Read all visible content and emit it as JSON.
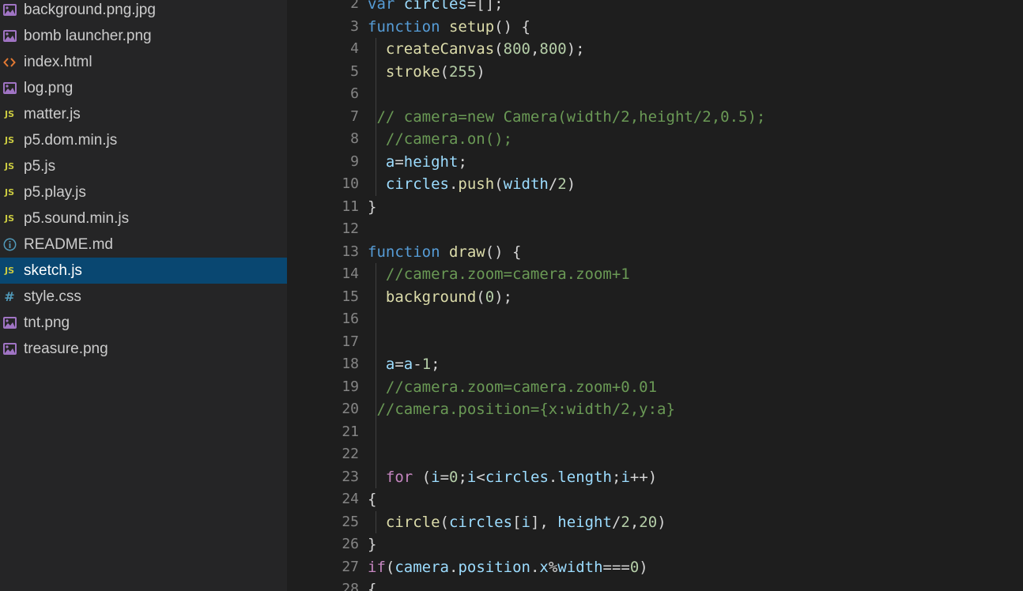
{
  "explorer": {
    "files": [
      {
        "name": "background.png.jpg",
        "icon": "image-file-icon",
        "selected": false
      },
      {
        "name": "bomb launcher.png",
        "icon": "image-file-icon",
        "selected": false
      },
      {
        "name": "index.html",
        "icon": "html-file-icon",
        "selected": false
      },
      {
        "name": "log.png",
        "icon": "image-file-icon",
        "selected": false
      },
      {
        "name": "matter.js",
        "icon": "js-file-icon",
        "selected": false
      },
      {
        "name": "p5.dom.min.js",
        "icon": "js-file-icon",
        "selected": false
      },
      {
        "name": "p5.js",
        "icon": "js-file-icon",
        "selected": false
      },
      {
        "name": "p5.play.js",
        "icon": "js-file-icon",
        "selected": false
      },
      {
        "name": "p5.sound.min.js",
        "icon": "js-file-icon",
        "selected": false
      },
      {
        "name": "README.md",
        "icon": "info-icon",
        "selected": false
      },
      {
        "name": "sketch.js",
        "icon": "js-file-icon",
        "selected": true
      },
      {
        "name": "style.css",
        "icon": "css-hash-icon",
        "selected": false
      },
      {
        "name": "tnt.png",
        "icon": "image-file-icon",
        "selected": false
      },
      {
        "name": "treasure.png",
        "icon": "image-file-icon",
        "selected": false
      }
    ]
  },
  "colors": {
    "sidebar_bg": "#252526",
    "editor_bg": "#1e1e1e",
    "selection": "#094771",
    "keyword": "#569cd6",
    "control": "#c586c0",
    "function": "#dcdcaa",
    "variable": "#9cdcfe",
    "number": "#b5cea8",
    "comment": "#6a9955",
    "js_icon": "#cbcb41",
    "image_icon": "#a074c4",
    "html_icon": "#e37933",
    "info_icon": "#519aba"
  },
  "editor": {
    "lines": [
      {
        "n": "2",
        "tokens": [
          [
            "kw",
            "var"
          ],
          [
            "p",
            " "
          ],
          [
            "var",
            "circles"
          ],
          [
            "p",
            "=[];"
          ]
        ]
      },
      {
        "n": "3",
        "tokens": [
          [
            "kw",
            "function"
          ],
          [
            "p",
            " "
          ],
          [
            "fn",
            "setup"
          ],
          [
            "p",
            "() {"
          ]
        ]
      },
      {
        "n": "4",
        "tokens": [
          [
            "p",
            "  "
          ],
          [
            "fn",
            "createCanvas"
          ],
          [
            "p",
            "("
          ],
          [
            "num",
            "800"
          ],
          [
            "p",
            ","
          ],
          [
            "num",
            "800"
          ],
          [
            "p",
            ");"
          ]
        ]
      },
      {
        "n": "5",
        "tokens": [
          [
            "p",
            "  "
          ],
          [
            "fn",
            "stroke"
          ],
          [
            "p",
            "("
          ],
          [
            "num",
            "255"
          ],
          [
            "p",
            ")"
          ]
        ]
      },
      {
        "n": "6",
        "tokens": []
      },
      {
        "n": "7",
        "tokens": [
          [
            "p",
            " "
          ],
          [
            "cmt",
            "// camera=new Camera(width/2,height/2,0.5);"
          ]
        ]
      },
      {
        "n": "8",
        "tokens": [
          [
            "p",
            "  "
          ],
          [
            "cmt",
            "//camera.on();"
          ]
        ]
      },
      {
        "n": "9",
        "tokens": [
          [
            "p",
            "  "
          ],
          [
            "var",
            "a"
          ],
          [
            "p",
            "="
          ],
          [
            "var",
            "height"
          ],
          [
            "p",
            ";"
          ]
        ]
      },
      {
        "n": "10",
        "tokens": [
          [
            "p",
            "  "
          ],
          [
            "var",
            "circles"
          ],
          [
            "p",
            "."
          ],
          [
            "fn",
            "push"
          ],
          [
            "p",
            "("
          ],
          [
            "var",
            "width"
          ],
          [
            "p",
            "/"
          ],
          [
            "num",
            "2"
          ],
          [
            "p",
            ")"
          ]
        ]
      },
      {
        "n": "11",
        "tokens": [
          [
            "p",
            "}"
          ]
        ]
      },
      {
        "n": "12",
        "tokens": []
      },
      {
        "n": "13",
        "tokens": [
          [
            "kw",
            "function"
          ],
          [
            "p",
            " "
          ],
          [
            "fn",
            "draw"
          ],
          [
            "p",
            "() {"
          ]
        ]
      },
      {
        "n": "14",
        "tokens": [
          [
            "p",
            "  "
          ],
          [
            "cmt",
            "//camera.zoom=camera.zoom+1"
          ]
        ]
      },
      {
        "n": "15",
        "tokens": [
          [
            "p",
            "  "
          ],
          [
            "fn",
            "background"
          ],
          [
            "p",
            "("
          ],
          [
            "num",
            "0"
          ],
          [
            "p",
            ");"
          ]
        ]
      },
      {
        "n": "16",
        "tokens": []
      },
      {
        "n": "17",
        "tokens": []
      },
      {
        "n": "18",
        "tokens": [
          [
            "p",
            "  "
          ],
          [
            "var",
            "a"
          ],
          [
            "p",
            "="
          ],
          [
            "var",
            "a"
          ],
          [
            "p",
            "-"
          ],
          [
            "num",
            "1"
          ],
          [
            "p",
            ";"
          ]
        ]
      },
      {
        "n": "19",
        "tokens": [
          [
            "p",
            "  "
          ],
          [
            "cmt",
            "//camera.zoom=camera.zoom+0.01"
          ]
        ]
      },
      {
        "n": "20",
        "tokens": [
          [
            "p",
            " "
          ],
          [
            "cmt",
            "//camera.position={x:width/2,y:a}"
          ]
        ]
      },
      {
        "n": "21",
        "tokens": []
      },
      {
        "n": "22",
        "tokens": []
      },
      {
        "n": "23",
        "tokens": [
          [
            "p",
            "  "
          ],
          [
            "ctl",
            "for"
          ],
          [
            "p",
            " ("
          ],
          [
            "var",
            "i"
          ],
          [
            "p",
            "="
          ],
          [
            "num",
            "0"
          ],
          [
            "p",
            ";"
          ],
          [
            "var",
            "i"
          ],
          [
            "p",
            "<"
          ],
          [
            "var",
            "circles"
          ],
          [
            "p",
            "."
          ],
          [
            "var",
            "length"
          ],
          [
            "p",
            ";"
          ],
          [
            "var",
            "i"
          ],
          [
            "p",
            "++)"
          ]
        ]
      },
      {
        "n": "24",
        "tokens": [
          [
            "p",
            "{"
          ]
        ]
      },
      {
        "n": "25",
        "tokens": [
          [
            "p",
            "  "
          ],
          [
            "fn",
            "circle"
          ],
          [
            "p",
            "("
          ],
          [
            "var",
            "circles"
          ],
          [
            "p",
            "["
          ],
          [
            "var",
            "i"
          ],
          [
            "p",
            "], "
          ],
          [
            "var",
            "height"
          ],
          [
            "p",
            "/"
          ],
          [
            "num",
            "2"
          ],
          [
            "p",
            ","
          ],
          [
            "num",
            "20"
          ],
          [
            "p",
            ")"
          ]
        ]
      },
      {
        "n": "26",
        "tokens": [
          [
            "p",
            "}"
          ]
        ]
      },
      {
        "n": "27",
        "tokens": [
          [
            "ctl",
            "if"
          ],
          [
            "p",
            "("
          ],
          [
            "var",
            "camera"
          ],
          [
            "p",
            "."
          ],
          [
            "var",
            "position"
          ],
          [
            "p",
            "."
          ],
          [
            "var",
            "x"
          ],
          [
            "p",
            "%"
          ],
          [
            "var",
            "width"
          ],
          [
            "p",
            "==="
          ],
          [
            "num",
            "0"
          ],
          [
            "p",
            ")"
          ]
        ]
      },
      {
        "n": "28",
        "tokens": [
          [
            "p",
            "{"
          ]
        ]
      }
    ],
    "indent_guides": [
      4,
      5,
      6,
      7,
      8,
      9,
      10,
      14,
      15,
      16,
      17,
      18,
      19,
      20,
      21,
      22,
      23,
      25
    ]
  }
}
